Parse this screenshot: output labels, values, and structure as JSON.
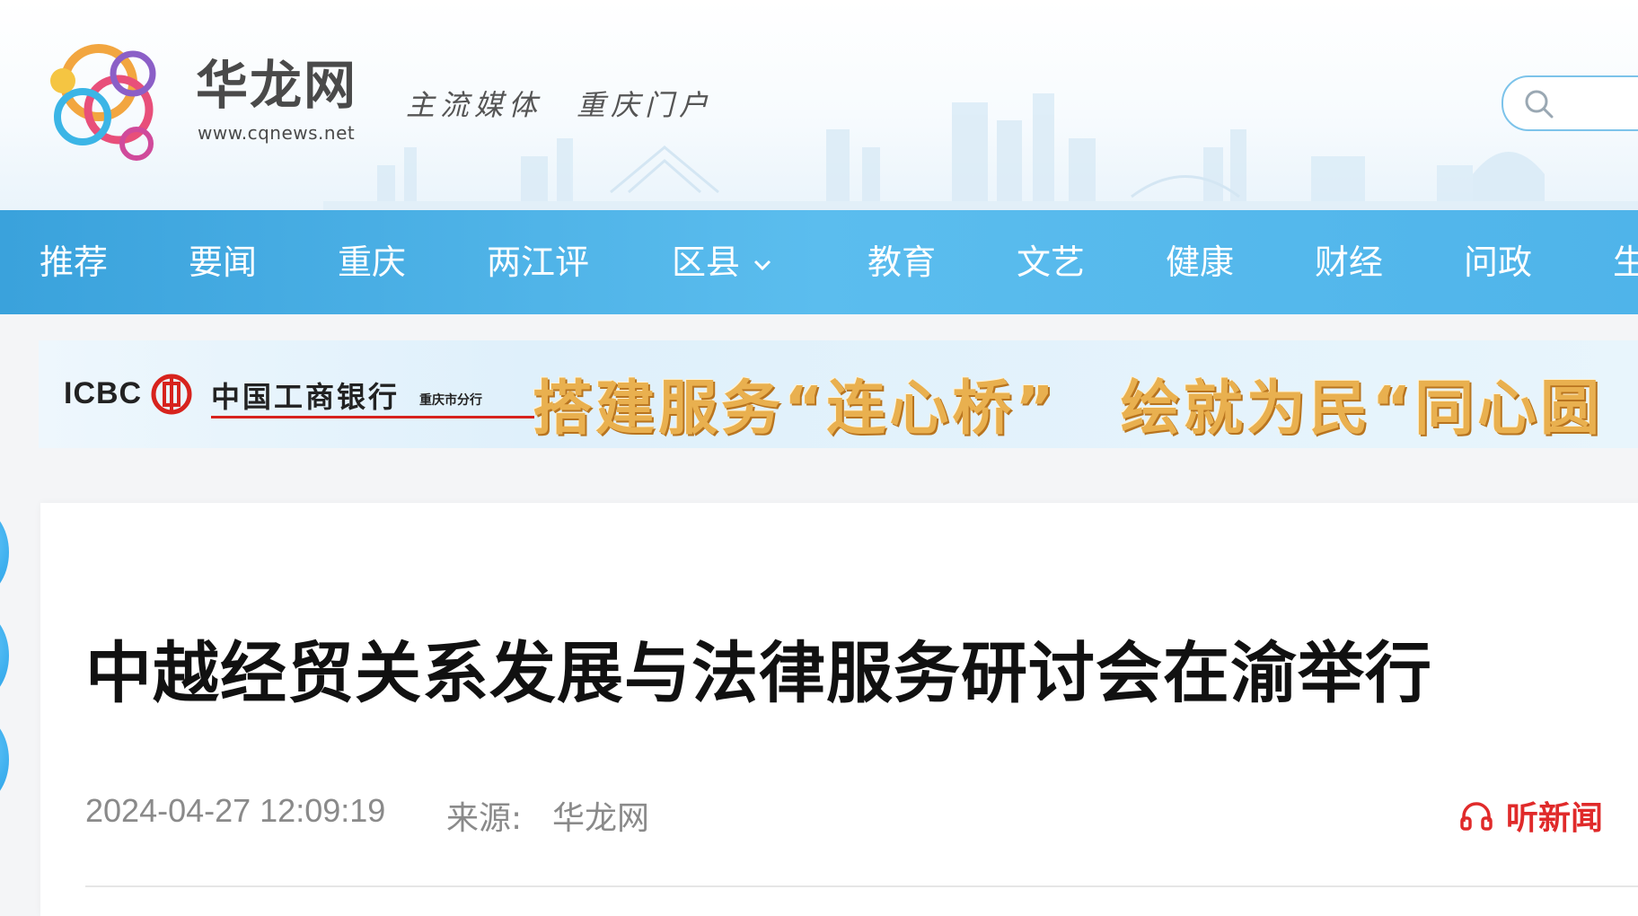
{
  "header": {
    "brand_title": "华龙网",
    "brand_url": "www.cqnews.net",
    "slogan": "主流媒体　重庆门户",
    "logo_icon": "dragon-logo-icon",
    "search_icon": "search-icon",
    "search_placeholder": ""
  },
  "nav": {
    "items": [
      {
        "label": "推荐"
      },
      {
        "label": "要闻"
      },
      {
        "label": "重庆"
      },
      {
        "label": "两江评"
      },
      {
        "label": "区县",
        "icon": "chevron-down-icon"
      },
      {
        "label": "教育"
      },
      {
        "label": "文艺"
      },
      {
        "label": "健康"
      },
      {
        "label": "财经"
      },
      {
        "label": "问政"
      },
      {
        "label": "生"
      }
    ],
    "color": "#4fb4ea"
  },
  "banner": {
    "icbc": "ICBC",
    "bank_name": "中国工商银行",
    "bank_branch": "重庆市分行",
    "slogan": "搭建服务“连心桥”　绘就为民“同心圆"
  },
  "article": {
    "title": "中越经贸关系发展与法律服务研讨会在渝举行",
    "date": "2024-04-27 12:09:19",
    "source_label": "来源:",
    "source": "华龙网",
    "listen_label": "听新闻",
    "listen_icon": "headphones-icon",
    "accent_color": "#e02a2a"
  }
}
